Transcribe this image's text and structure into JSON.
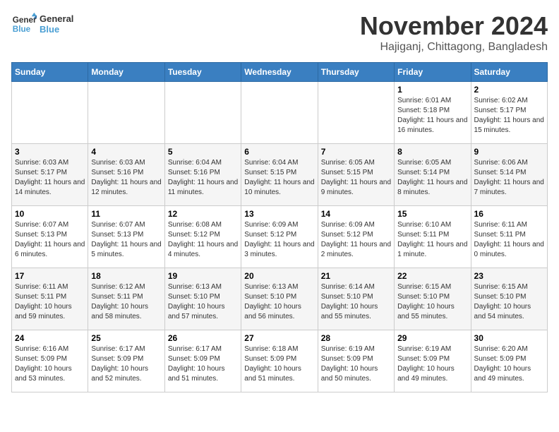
{
  "logo": {
    "line1": "General",
    "line2": "Blue"
  },
  "title": "November 2024",
  "location": "Hajiganj, Chittagong, Bangladesh",
  "weekdays": [
    "Sunday",
    "Monday",
    "Tuesday",
    "Wednesday",
    "Thursday",
    "Friday",
    "Saturday"
  ],
  "weeks": [
    [
      {
        "day": "",
        "info": ""
      },
      {
        "day": "",
        "info": ""
      },
      {
        "day": "",
        "info": ""
      },
      {
        "day": "",
        "info": ""
      },
      {
        "day": "",
        "info": ""
      },
      {
        "day": "1",
        "info": "Sunrise: 6:01 AM\nSunset: 5:18 PM\nDaylight: 11 hours and 16 minutes."
      },
      {
        "day": "2",
        "info": "Sunrise: 6:02 AM\nSunset: 5:17 PM\nDaylight: 11 hours and 15 minutes."
      }
    ],
    [
      {
        "day": "3",
        "info": "Sunrise: 6:03 AM\nSunset: 5:17 PM\nDaylight: 11 hours and 14 minutes."
      },
      {
        "day": "4",
        "info": "Sunrise: 6:03 AM\nSunset: 5:16 PM\nDaylight: 11 hours and 12 minutes."
      },
      {
        "day": "5",
        "info": "Sunrise: 6:04 AM\nSunset: 5:16 PM\nDaylight: 11 hours and 11 minutes."
      },
      {
        "day": "6",
        "info": "Sunrise: 6:04 AM\nSunset: 5:15 PM\nDaylight: 11 hours and 10 minutes."
      },
      {
        "day": "7",
        "info": "Sunrise: 6:05 AM\nSunset: 5:15 PM\nDaylight: 11 hours and 9 minutes."
      },
      {
        "day": "8",
        "info": "Sunrise: 6:05 AM\nSunset: 5:14 PM\nDaylight: 11 hours and 8 minutes."
      },
      {
        "day": "9",
        "info": "Sunrise: 6:06 AM\nSunset: 5:14 PM\nDaylight: 11 hours and 7 minutes."
      }
    ],
    [
      {
        "day": "10",
        "info": "Sunrise: 6:07 AM\nSunset: 5:13 PM\nDaylight: 11 hours and 6 minutes."
      },
      {
        "day": "11",
        "info": "Sunrise: 6:07 AM\nSunset: 5:13 PM\nDaylight: 11 hours and 5 minutes."
      },
      {
        "day": "12",
        "info": "Sunrise: 6:08 AM\nSunset: 5:12 PM\nDaylight: 11 hours and 4 minutes."
      },
      {
        "day": "13",
        "info": "Sunrise: 6:09 AM\nSunset: 5:12 PM\nDaylight: 11 hours and 3 minutes."
      },
      {
        "day": "14",
        "info": "Sunrise: 6:09 AM\nSunset: 5:12 PM\nDaylight: 11 hours and 2 minutes."
      },
      {
        "day": "15",
        "info": "Sunrise: 6:10 AM\nSunset: 5:11 PM\nDaylight: 11 hours and 1 minute."
      },
      {
        "day": "16",
        "info": "Sunrise: 6:11 AM\nSunset: 5:11 PM\nDaylight: 11 hours and 0 minutes."
      }
    ],
    [
      {
        "day": "17",
        "info": "Sunrise: 6:11 AM\nSunset: 5:11 PM\nDaylight: 10 hours and 59 minutes."
      },
      {
        "day": "18",
        "info": "Sunrise: 6:12 AM\nSunset: 5:11 PM\nDaylight: 10 hours and 58 minutes."
      },
      {
        "day": "19",
        "info": "Sunrise: 6:13 AM\nSunset: 5:10 PM\nDaylight: 10 hours and 57 minutes."
      },
      {
        "day": "20",
        "info": "Sunrise: 6:13 AM\nSunset: 5:10 PM\nDaylight: 10 hours and 56 minutes."
      },
      {
        "day": "21",
        "info": "Sunrise: 6:14 AM\nSunset: 5:10 PM\nDaylight: 10 hours and 55 minutes."
      },
      {
        "day": "22",
        "info": "Sunrise: 6:15 AM\nSunset: 5:10 PM\nDaylight: 10 hours and 55 minutes."
      },
      {
        "day": "23",
        "info": "Sunrise: 6:15 AM\nSunset: 5:10 PM\nDaylight: 10 hours and 54 minutes."
      }
    ],
    [
      {
        "day": "24",
        "info": "Sunrise: 6:16 AM\nSunset: 5:09 PM\nDaylight: 10 hours and 53 minutes."
      },
      {
        "day": "25",
        "info": "Sunrise: 6:17 AM\nSunset: 5:09 PM\nDaylight: 10 hours and 52 minutes."
      },
      {
        "day": "26",
        "info": "Sunrise: 6:17 AM\nSunset: 5:09 PM\nDaylight: 10 hours and 51 minutes."
      },
      {
        "day": "27",
        "info": "Sunrise: 6:18 AM\nSunset: 5:09 PM\nDaylight: 10 hours and 51 minutes."
      },
      {
        "day": "28",
        "info": "Sunrise: 6:19 AM\nSunset: 5:09 PM\nDaylight: 10 hours and 50 minutes."
      },
      {
        "day": "29",
        "info": "Sunrise: 6:19 AM\nSunset: 5:09 PM\nDaylight: 10 hours and 49 minutes."
      },
      {
        "day": "30",
        "info": "Sunrise: 6:20 AM\nSunset: 5:09 PM\nDaylight: 10 hours and 49 minutes."
      }
    ]
  ]
}
